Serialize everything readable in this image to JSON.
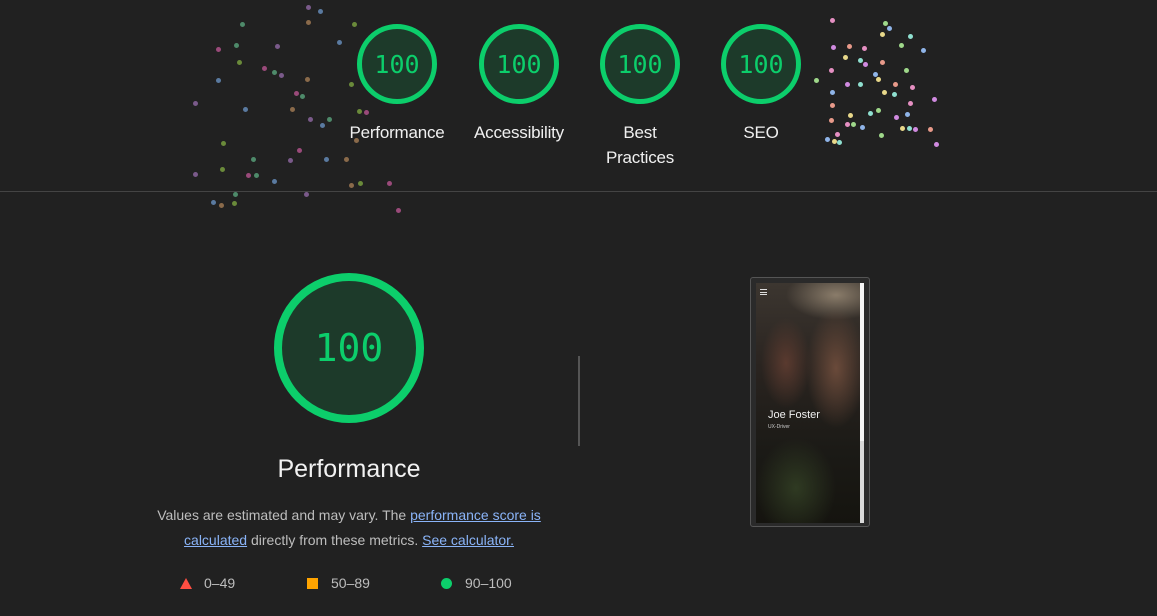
{
  "top_scores": [
    {
      "value": "100",
      "label": "Performance"
    },
    {
      "value": "100",
      "label": "Accessibility"
    },
    {
      "value": "100",
      "label": "Best Practices"
    },
    {
      "value": "100",
      "label": "SEO"
    }
  ],
  "performance": {
    "score": "100",
    "title": "Performance",
    "desc_prefix": "Values are estimated and may vary. The ",
    "desc_link1": "performance score is calculated",
    "desc_middle": " directly from these metrics. ",
    "desc_link2": "See calculator."
  },
  "legend": {
    "fail": "0–49",
    "average": "50–89",
    "pass": "90–100"
  },
  "screenshot": {
    "name": "Joe Foster",
    "subtitle": "UX-Driver"
  },
  "colors": {
    "pass": "#0cce6b",
    "average": "#ffa400",
    "fail": "#ff4e42",
    "link": "#8ab4f8",
    "background": "#212121"
  }
}
